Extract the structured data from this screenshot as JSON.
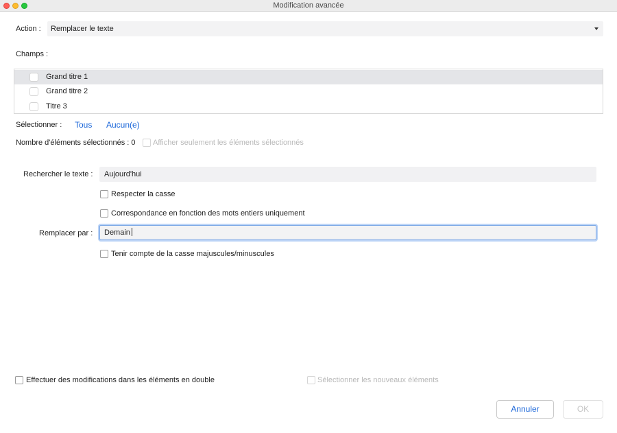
{
  "window": {
    "title": "Modification avancée"
  },
  "action": {
    "label": "Action :",
    "selected": "Remplacer le texte"
  },
  "fields": {
    "label": "Champs :",
    "items": [
      "Grand titre 1",
      "Grand titre 2",
      "Titre 3"
    ]
  },
  "selection": {
    "label": "Sélectionner :",
    "all": "Tous",
    "none": "Aucun(e)",
    "count_label": "Nombre d'éléments sélectionnés : 0",
    "show_selected_only": "Afficher seulement les éléments sélectionnés"
  },
  "search": {
    "label": "Rechercher le texte :",
    "value": "Aujourd'hui",
    "match_case": "Respecter la casse",
    "whole_words": "Correspondance en fonction des mots entiers uniquement"
  },
  "replace": {
    "label": "Remplacer par :",
    "value": "Demain",
    "respect_case": "Tenir compte de la casse majuscules/minuscules"
  },
  "footer": {
    "duplicates": "Effectuer des modifications dans les éléments en double",
    "select_new": "Sélectionner les nouveaux éléments",
    "cancel": "Annuler",
    "ok": "OK"
  },
  "colors": {
    "accent": "#1a66d9",
    "focus_ring": "#7aa7e6",
    "disabled_text": "#b8b8b8"
  }
}
